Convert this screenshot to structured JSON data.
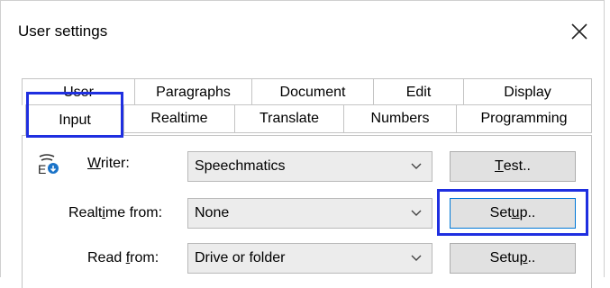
{
  "window": {
    "title": "User settings"
  },
  "tabs": {
    "back_row": [
      "User",
      "Paragraphs",
      "Document",
      "Edit",
      "Display"
    ],
    "front_row": [
      "Input",
      "Realtime",
      "Translate",
      "Numbers",
      "Programming"
    ],
    "active": "Input"
  },
  "form": {
    "writer": {
      "label_pre": "",
      "label_access": "W",
      "label_post": "riter:",
      "value": "Speechmatics",
      "button_pre": "",
      "button_access": "T",
      "button_post": "est.."
    },
    "realtime_from": {
      "label_pre": "Realt",
      "label_access": "i",
      "label_post": "me from:",
      "value": "None",
      "button_pre": "Set",
      "button_access": "u",
      "button_post": "p.."
    },
    "read_from": {
      "label_pre": "Read ",
      "label_access": "f",
      "label_post": "rom:",
      "value": "Drive or folder",
      "button_pre": "Setu",
      "button_access": "p",
      "button_post": ".."
    }
  },
  "colors": {
    "highlight": "#1f2fe0",
    "focus": "#0078d7"
  },
  "icons": {
    "close": "close-icon",
    "writer": "writer-icon",
    "dropdown": "chevron-down-icon"
  }
}
